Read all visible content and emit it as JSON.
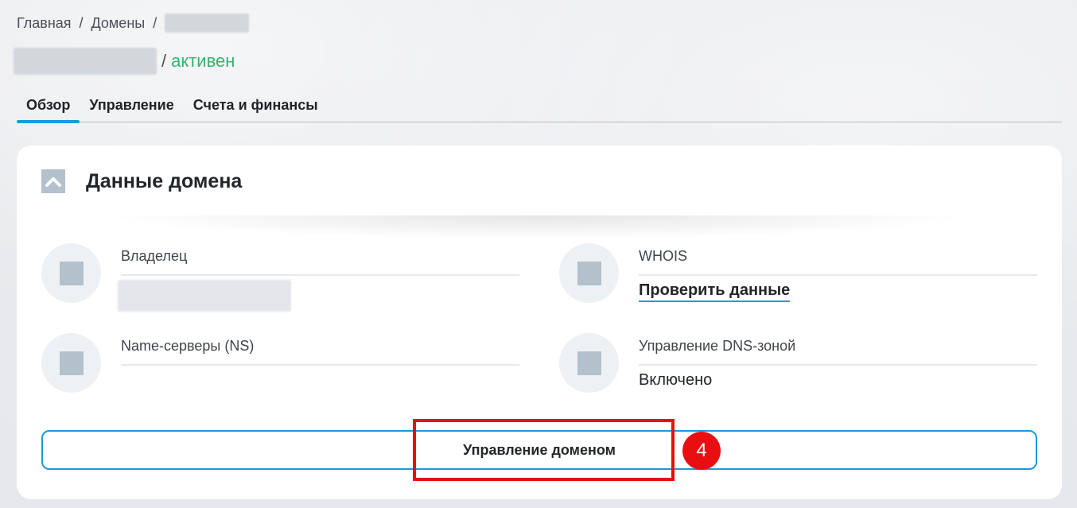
{
  "breadcrumb": {
    "home": "Главная",
    "separator": "/",
    "domains": "Домены",
    "separator2": "/"
  },
  "title": {
    "separator": "/",
    "status": "активен",
    "status_color": "#39b36b"
  },
  "tabs": [
    {
      "label": "Обзор",
      "active": true
    },
    {
      "label": "Управление",
      "active": false
    },
    {
      "label": "Счета и финансы",
      "active": false
    }
  ],
  "card": {
    "title": "Данные домена",
    "collapse_icon": "chevron-up-icon",
    "fields": {
      "owner": {
        "label": "Владелец"
      },
      "whois": {
        "label": "WHOIS",
        "link": "Проверить данные"
      },
      "ns": {
        "label": "Name-серверы (NS)"
      },
      "dns": {
        "label": "Управление DNS-зоной",
        "value": "Включено"
      }
    },
    "manage_button": "Управление доменом"
  },
  "annotation": {
    "step": "4",
    "color": "#e80e12"
  },
  "accent_color": "#1a9bd7"
}
